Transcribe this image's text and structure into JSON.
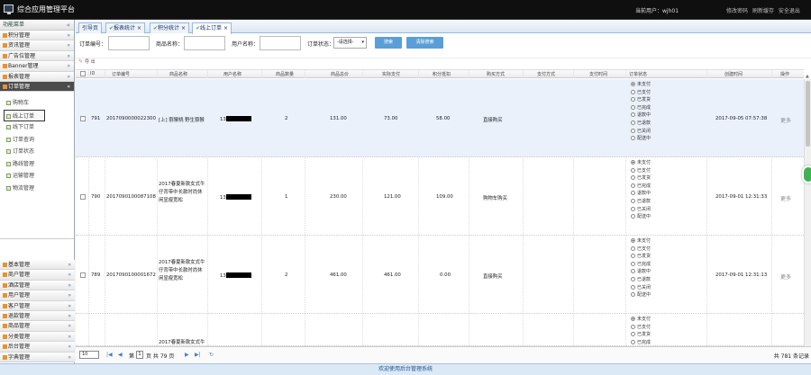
{
  "app": {
    "title": "综合应用管理平台",
    "user": "当前用户：wjh01",
    "top_links": [
      "修改密码",
      "刷新缓存",
      "安全退出"
    ]
  },
  "sidebar": {
    "header": "功能菜单",
    "top_menus": [
      "积分管理",
      "资讯管理",
      "广告位管理",
      "Banner管理",
      "报表管理"
    ],
    "active_menu": "订单管理",
    "sub_items": [
      "购物车",
      "线上订单",
      "线下订单",
      "订单查询",
      "订单状态",
      "路线管理",
      "运输管理",
      "物流管理"
    ],
    "lower_menus": [
      "基本管理",
      "商户管理",
      "酒店管理",
      "用户管理",
      "客户管理",
      "退款管理",
      "商品管理",
      "分类管理",
      "后台管理",
      "字典管理"
    ]
  },
  "tabs": [
    {
      "label": "引导页"
    },
    {
      "label": "报表统计 ×",
      "ok": "✔"
    },
    {
      "label": "积分统计 ×",
      "ok": "✔"
    },
    {
      "label": "线上订单 ×",
      "ok": "✔"
    }
  ],
  "filter": {
    "order_no_label": "订单编号：",
    "product_label": "商品名称：",
    "username_label": "用户名称：",
    "status_label": "订单状态：",
    "status_value": "-请选择-",
    "search_btn": "搜索",
    "reset_btn": "清除搜索"
  },
  "toolbar": {
    "label": "导 出"
  },
  "columns": [
    "ID",
    "订单编号",
    "商品名称",
    "用户名称",
    "商品数量",
    "商品总价",
    "实际支付",
    "积分抵扣",
    "购买方式",
    "支付方式",
    "支付时间",
    "订单状态",
    "创建时间",
    "操作"
  ],
  "status_options": [
    "未支付",
    "已支付",
    "已发货",
    "已完成",
    "退款中",
    "已退款",
    "已关闭",
    "配送中"
  ],
  "rows": [
    {
      "id": "791",
      "order_no": "2017090000022300",
      "product": "[上] 猕猴桃 野生猕猴",
      "user": "13",
      "qty": "2",
      "total": "131.00",
      "paid": "73.00",
      "points": "58.00",
      "buy": "直接购买",
      "pay_method": "",
      "pay_time": "",
      "status_index": 0,
      "created": "2017-09-05 07:57:38",
      "op": "更多",
      "selected": true
    },
    {
      "id": "790",
      "order_no": "2017090100087108",
      "product": "2017春夏新款女式牛仔背带中长款时尚休闲显瘦宽松",
      "user": "13",
      "qty": "1",
      "total": "230.00",
      "paid": "121.00",
      "points": "109.00",
      "buy": "购物车购买",
      "pay_method": "",
      "pay_time": "",
      "status_index": 0,
      "created": "2017-09-01 12:31:33",
      "op": "更多",
      "selected": false
    },
    {
      "id": "789",
      "order_no": "2017090100001672",
      "product": "2017春夏新款女式牛仔背带中长款时尚休闲显瘦宽松",
      "user": "13",
      "qty": "2",
      "total": "461.00",
      "paid": "461.00",
      "points": "0.00",
      "buy": "直接购买",
      "pay_method": "",
      "pay_time": "",
      "status_index": 0,
      "created": "2017-09-01 12:31:13",
      "op": "更多",
      "selected": false
    },
    {
      "id": "",
      "order_no": "",
      "product": "2017春夏新款女式牛",
      "user": "",
      "qty": "",
      "total": "",
      "paid": "",
      "points": "",
      "buy": "",
      "pay_method": "",
      "pay_time": "",
      "status_index": 0,
      "created": "",
      "op": "",
      "selected": false
    }
  ],
  "pager": {
    "page_size": "10",
    "page_prefix": "第",
    "page_value": "1",
    "page_suffix": "页 共 79 页",
    "total": "共 781 条记录",
    "first": "|◀",
    "prev": "◀",
    "next": "▶",
    "last": "▶|",
    "refresh": "↻"
  },
  "footer": "欢迎使用后台管理系统"
}
